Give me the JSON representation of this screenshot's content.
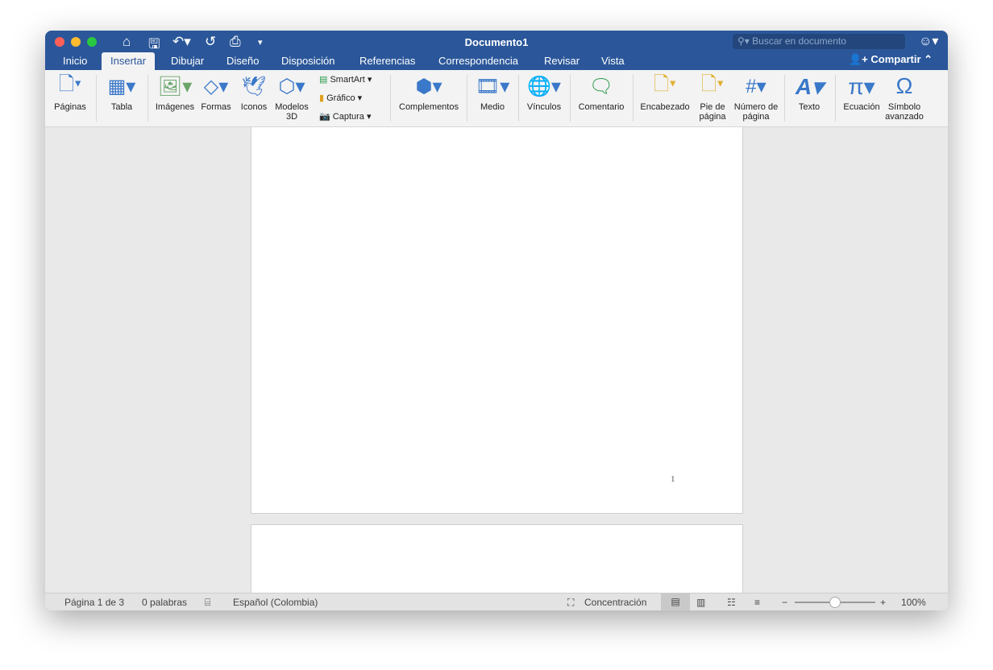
{
  "window": {
    "title": "Documento1",
    "search_placeholder": "Buscar en documento"
  },
  "traffic_lights": {
    "close": "#fe5f57",
    "minimize": "#febc2e",
    "zoom": "#28c840"
  },
  "quick_access": [
    "home-icon",
    "save-icon",
    "undo-icon",
    "redo-icon",
    "print-icon",
    "customize-icon"
  ],
  "tabs": [
    "Inicio",
    "Insertar",
    "Dibujar",
    "Diseño",
    "Disposición",
    "Referencias",
    "Correspondencia",
    "Revisar",
    "Vista"
  ],
  "active_tab": "Insertar",
  "share_label": "Compartir",
  "ribbon": {
    "paginas": "Páginas",
    "tabla": "Tabla",
    "imagenes": "Imágenes",
    "formas": "Formas",
    "iconos": "Iconos",
    "modelos": "Modelos 3D",
    "smartart": "SmartArt",
    "grafico": "Gráfico",
    "captura": "Captura",
    "complementos": "Complementos",
    "medio": "Medio",
    "vinculos": "Vínculos",
    "comentario": "Comentario",
    "encabezado": "Encabezado",
    "pie": "Pie de página",
    "numero": "Número de página",
    "texto": "Texto",
    "ecuacion": "Ecuación",
    "simbolo": "Símbolo avanzado"
  },
  "document": {
    "page_number": "1"
  },
  "status": {
    "page": "Página 1 de 3",
    "words": "0 palabras",
    "language": "Español (Colombia)",
    "focus": "Concentración",
    "zoom": "100%",
    "zoom_level": 100
  },
  "colors": {
    "brand": "#2b579a"
  }
}
